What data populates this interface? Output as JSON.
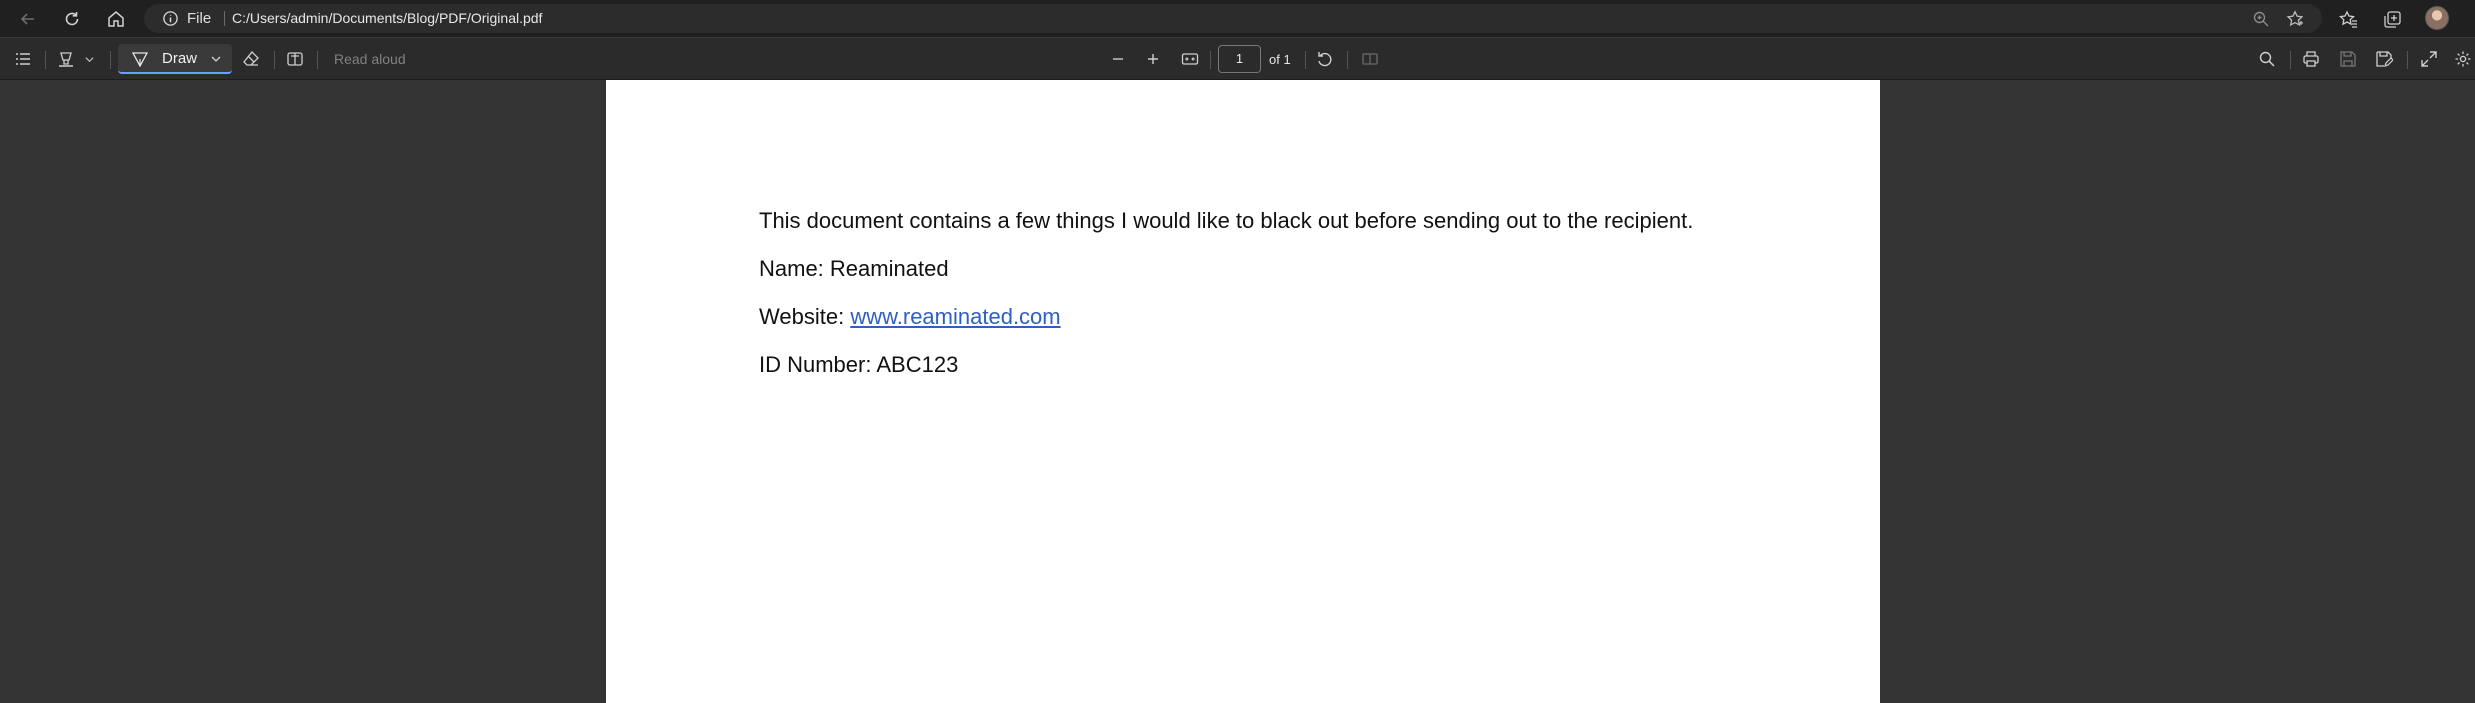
{
  "browser": {
    "address_scheme_label": "File",
    "url": "C:/Users/admin/Documents/Blog/PDF/Original.pdf"
  },
  "toolbar": {
    "draw_label": "Draw",
    "read_aloud_label": "Read aloud",
    "page_number": "1",
    "page_total_label": "of 1"
  },
  "document": {
    "intro": "This document contains a few things I would like to black out before sending out to the recipient.",
    "name_label": "Name: ",
    "name_value": "Reaminated",
    "website_label": "Website: ",
    "website_value": "www.reaminated.com",
    "id_label": "ID Number: ",
    "id_value": "ABC123"
  },
  "colors": {
    "chrome_dark": "#202020",
    "toolbar": "#2b2b2b",
    "viewer_background": "#333333",
    "page": "#ffffff",
    "link": "#2f5fc4",
    "accent": "#6aa0ff"
  },
  "icons": {
    "titlebar": [
      "back-icon",
      "refresh-icon",
      "home-icon",
      "info-icon",
      "zoom-icon",
      "favorite-star-icon",
      "favorites-icon",
      "collections-icon",
      "profile-avatar"
    ],
    "toolbar": [
      "contents-icon",
      "highlight-icon",
      "chevron-down-icon",
      "draw-pen-icon",
      "eraser-icon",
      "text-box-icon",
      "zoom-out-icon",
      "zoom-in-icon",
      "fit-page-icon",
      "rotate-icon",
      "page-view-icon",
      "search-icon",
      "print-icon",
      "save-icon",
      "save-as-icon",
      "fullscreen-icon",
      "settings-icon"
    ]
  }
}
